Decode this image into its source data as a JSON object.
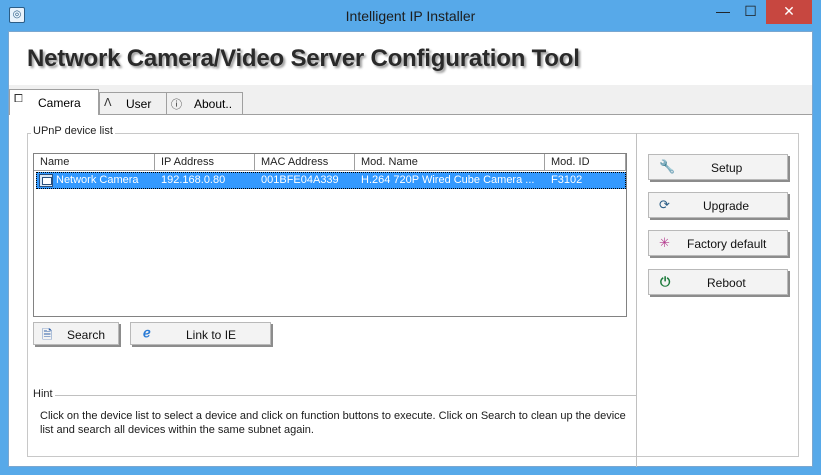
{
  "window": {
    "title": "Intelligent IP Installer",
    "controls": {
      "minimize": "—",
      "maximize": "☐",
      "close": "✕"
    }
  },
  "banner": {
    "title": "Network Camera/Video Server Configuration Tool"
  },
  "tabs": [
    {
      "label": "Camera",
      "icon": "camera-tab-icon",
      "glyph": "⧠",
      "active": true
    },
    {
      "label": "User",
      "icon": "user-tab-icon",
      "glyph": "ᐱ",
      "active": false
    },
    {
      "label": "About..",
      "icon": "info-tab-icon",
      "glyph": "ⓘ",
      "active": false
    }
  ],
  "upnp": {
    "group_label": "UPnP device list",
    "columns": [
      "Name",
      "IP Address",
      "MAC Address",
      "Mod. Name",
      "Mod. ID"
    ],
    "rows": [
      {
        "name": "Network Camera",
        "ip": "192.168.0.80",
        "mac": "001BFE04A339",
        "model_name": "H.264 720P Wired Cube Camera ...",
        "model_id": "F3102",
        "selected": true
      }
    ]
  },
  "buttons": {
    "search": "Search",
    "link_ie": "Link to IE",
    "setup": "Setup",
    "upgrade": "Upgrade",
    "factory_default": "Factory default",
    "reboot": "Reboot"
  },
  "hint": {
    "label": "Hint",
    "text": "Click on the device list to select a device and click on function buttons to execute. Click on Search to clean up the device list and search all devices  within the same subnet again."
  },
  "colors": {
    "titlebar": "#57a9e9",
    "selection": "#3399ff",
    "close_button": "#c74740"
  }
}
